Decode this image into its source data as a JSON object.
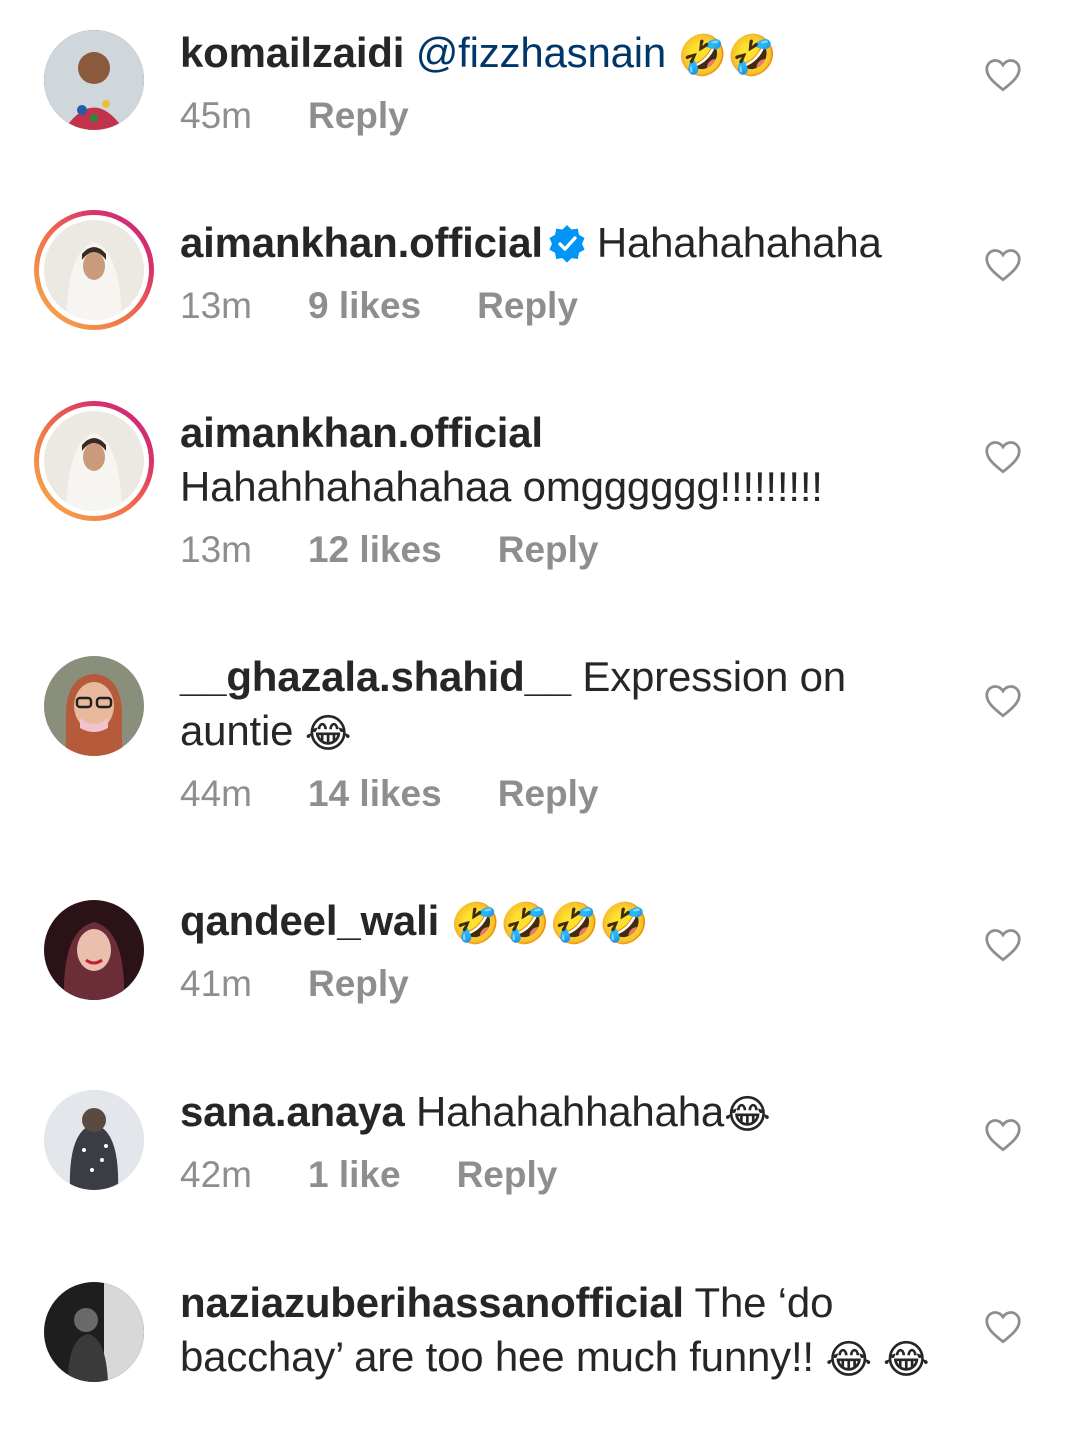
{
  "comments": [
    {
      "username": "komailzaidi",
      "mention": "@fizzhasnain",
      "text": "",
      "emoji": "🤣🤣",
      "time": "45m",
      "likes": "",
      "reply": "Reply",
      "verified": false,
      "story_ring": false,
      "avatar_color": "#5a3e2e"
    },
    {
      "username": "aimankhan.official",
      "mention": "",
      "text": "Hahahahahaha",
      "emoji": "",
      "time": "13m",
      "likes": "9 likes",
      "reply": "Reply",
      "verified": true,
      "story_ring": true,
      "avatar_color": "#e9e3dc"
    },
    {
      "username": "aimankhan.official",
      "mention": "",
      "text": "Hahahhahahahaa omgggggg!!!!!!!!!",
      "emoji": "",
      "time": "13m",
      "likes": "12 likes",
      "reply": "Reply",
      "verified": false,
      "story_ring": true,
      "avatar_color": "#e9e3dc"
    },
    {
      "username": "__ghazala.shahid__",
      "mention": "",
      "text": "Expression on auntie",
      "emoji": "😂",
      "time": "44m",
      "likes": "14 likes",
      "reply": "Reply",
      "verified": false,
      "story_ring": false,
      "avatar_color": "#b27b55"
    },
    {
      "username": "qandeel_wali",
      "mention": "",
      "text": "",
      "emoji": "🤣🤣🤣🤣",
      "time": "41m",
      "likes": "",
      "reply": "Reply",
      "verified": false,
      "story_ring": false,
      "avatar_color": "#3a1a22"
    },
    {
      "username": "sana.anaya",
      "mention": "",
      "text": "Hahahahhahaha",
      "emoji": "😂",
      "time": "42m",
      "likes": "1 like",
      "reply": "Reply",
      "verified": false,
      "story_ring": false,
      "avatar_color": "#d9dde2"
    },
    {
      "username": "naziazuberihassanofficial",
      "mention": "",
      "text": "The ‘do bacchay’ are too hee much funny!!",
      "emoji": "😂 😂",
      "time": "",
      "likes": "",
      "reply": "",
      "verified": false,
      "story_ring": false,
      "avatar_color": "#2b2b2b"
    }
  ],
  "colors": {
    "text": "#262626",
    "meta": "#8e8e8e",
    "mention": "#00376b",
    "verified": "#0095f6"
  },
  "icons": {
    "like": "heart-outline-icon",
    "verified": "verified-badge-icon"
  }
}
